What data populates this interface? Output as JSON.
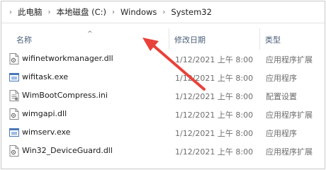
{
  "breadcrumb": {
    "items": [
      "此电脑",
      "本地磁盘 (C:)",
      "Windows",
      "System32"
    ]
  },
  "columns": {
    "name": "名称",
    "date": "修改日期",
    "type": "类型"
  },
  "files": [
    {
      "name": "wifinetworkmanager.dll",
      "date": "1/12/2021 上午 8:00",
      "type": "应用程序扩展",
      "icon": "dll-file-icon"
    },
    {
      "name": "wifitask.exe",
      "date": "1/12/2021 上午 8:00",
      "type": "应用程序",
      "icon": "exe-file-icon"
    },
    {
      "name": "WimBootCompress.ini",
      "date": "1/12/2021 上午 8:00",
      "type": "配置设置",
      "icon": "ini-file-icon"
    },
    {
      "name": "wimgapi.dll",
      "date": "1/12/2021 上午 8:00",
      "type": "应用程序扩展",
      "icon": "dll-file-icon"
    },
    {
      "name": "wimserv.exe",
      "date": "1/12/2021 上午 8:00",
      "type": "应用程序",
      "icon": "exe-file-icon"
    },
    {
      "name": "Win32_DeviceGuard.dll",
      "date": "1/12/2021 上午 8:00",
      "type": "应用程序扩展",
      "icon": "dll-file-icon"
    }
  ],
  "colors": {
    "annotation_arrow": "#e8423a",
    "header_text": "#4c607a"
  }
}
